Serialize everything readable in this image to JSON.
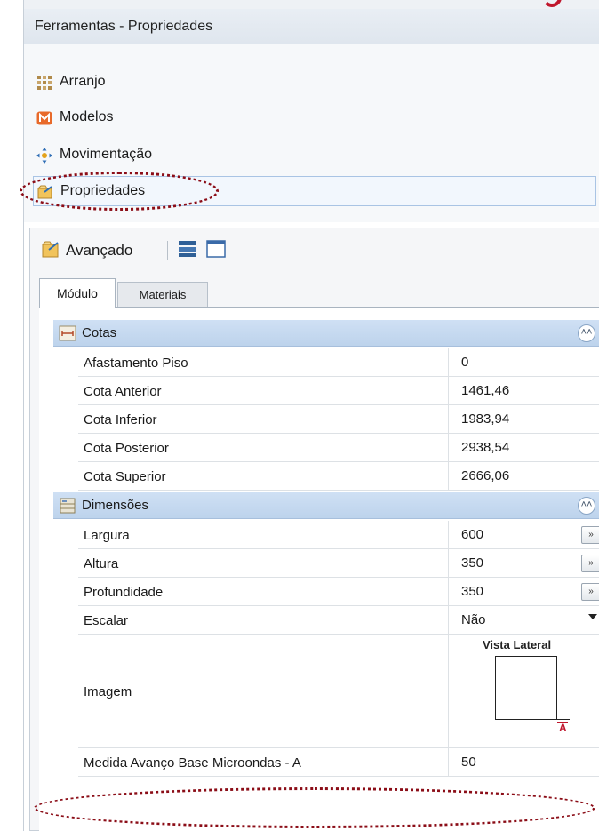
{
  "window": {
    "title": "Ferramentas - Propriedades"
  },
  "sections": [
    {
      "label": "Arranjo",
      "icon": "grid-arrange-icon"
    },
    {
      "label": "Modelos",
      "icon": "models-m-icon"
    },
    {
      "label": "Movimentação",
      "icon": "move-arrows-icon"
    },
    {
      "label": "Propriedades",
      "icon": "properties-folder-icon",
      "selected": true
    }
  ],
  "toolbar": {
    "advanced_label": "Avançado",
    "icons": [
      "advanced-properties-icon",
      "list-view-icon",
      "window-view-icon"
    ]
  },
  "tabs": [
    {
      "label": "Módulo",
      "active": true
    },
    {
      "label": "Materiais",
      "active": false
    }
  ],
  "groups": {
    "cotas": {
      "label": "Cotas",
      "rows": [
        {
          "name": "Afastamento Piso",
          "value": "0"
        },
        {
          "name": "Cota Anterior",
          "value": "1461,46"
        },
        {
          "name": "Cota Inferior",
          "value": "1983,94"
        },
        {
          "name": "Cota Posterior",
          "value": "2938,54"
        },
        {
          "name": "Cota Superior",
          "value": "2666,06"
        }
      ]
    },
    "dimensoes": {
      "label": "Dimensões",
      "rows": [
        {
          "name": "Largura",
          "value": "600",
          "editor": "ellipsis"
        },
        {
          "name": "Altura",
          "value": "350",
          "editor": "ellipsis"
        },
        {
          "name": "Profundidade",
          "value": "350",
          "editor": "ellipsis"
        },
        {
          "name": "Escalar",
          "value": "Não",
          "editor": "dropdown"
        }
      ],
      "image_row": {
        "name": "Imagem",
        "caption": "Vista Lateral",
        "marker": "A"
      },
      "last_row": {
        "name": "Medida Avanço Base Microondas - A",
        "value": "50"
      }
    }
  },
  "colors": {
    "highlight": "#8b0d17",
    "group_header": "#c6dbf1",
    "selection_border": "#a9c4e4"
  }
}
